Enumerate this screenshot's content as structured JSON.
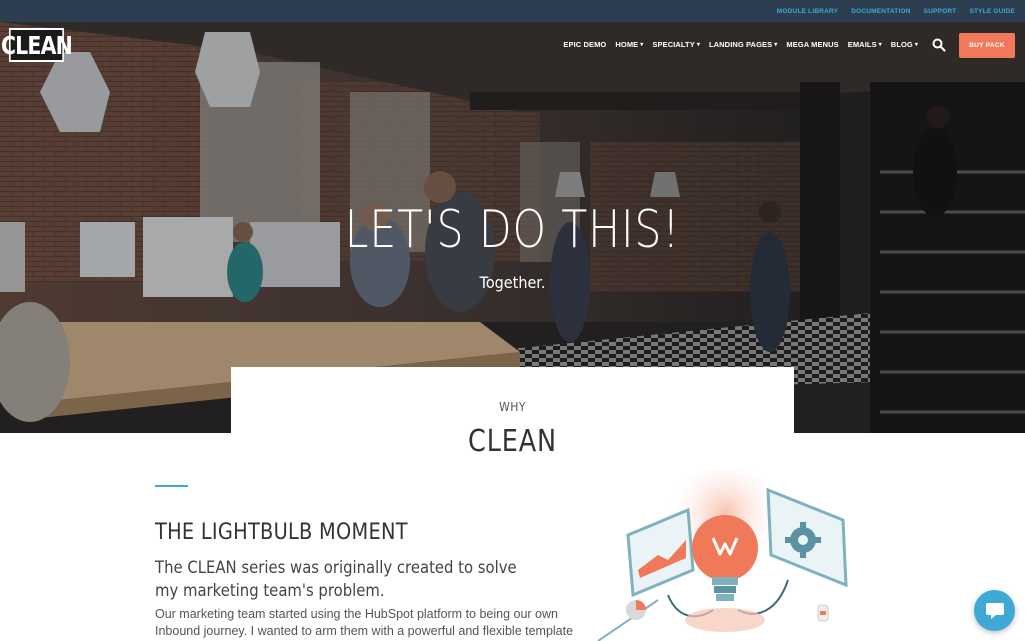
{
  "utility_nav": [
    "MODULE LIBRARY",
    "DOCUMENTATION",
    "SUPPORT",
    "STYLE GUIDE"
  ],
  "header": {
    "logo_text": "CLEAN",
    "nav": [
      {
        "label": "EPIC DEMO",
        "has_dropdown": false
      },
      {
        "label": "HOME",
        "has_dropdown": true
      },
      {
        "label": "SPECIALTY",
        "has_dropdown": true
      },
      {
        "label": "LANDING PAGES",
        "has_dropdown": true
      },
      {
        "label": "MEGA MENUS",
        "has_dropdown": false
      },
      {
        "label": "EMAILS",
        "has_dropdown": true
      },
      {
        "label": "BLOG",
        "has_dropdown": true
      }
    ],
    "search_icon": "search-icon",
    "cta_label": "BUY PACK"
  },
  "hero": {
    "title": "LET'S DO THIS!",
    "subtitle": "Together."
  },
  "why": {
    "label": "WHY",
    "title": "CLEAN"
  },
  "section": {
    "heading": "THE LIGHTBULB MOMENT",
    "lead": "The CLEAN series was originally created to solve my marketing team's problem.",
    "body": "Our marketing team started using the HubSpot platform to being our own Inbound journey. I wanted to arm them with a powerful and flexible template"
  },
  "chat": {
    "icon": "chat-bubble-icon"
  },
  "colors": {
    "accent_blue": "#3fa9d6",
    "cta_orange": "#f0795a",
    "utility_bar": "#2c3e50"
  }
}
